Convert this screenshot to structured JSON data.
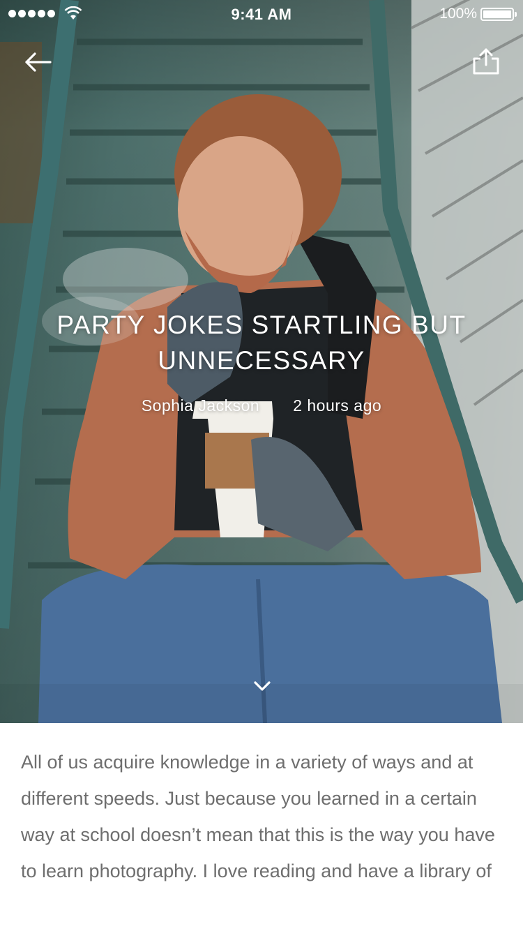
{
  "status_bar": {
    "time": "9:41 AM",
    "battery_percent": "100%",
    "signal_bars": 5
  },
  "nav": {
    "back_icon": "arrow-left-icon",
    "share_icon": "share-upload-icon"
  },
  "article": {
    "title": "PARTY JOKES STARTLING BUT UNNECESSARY",
    "author": "Sophia Jackson",
    "posted": "2 hours ago",
    "scroll_icon": "chevron-down-icon",
    "body": "All of us acquire knowledge in a variety of ways and at different speeds. Just because you learned in a certain way at school doesn’t mean that this is the way you have to learn photography. I love reading and have a library of"
  },
  "colors": {
    "text_body": "#6e6e6e",
    "overlay_text": "#ffffff"
  }
}
